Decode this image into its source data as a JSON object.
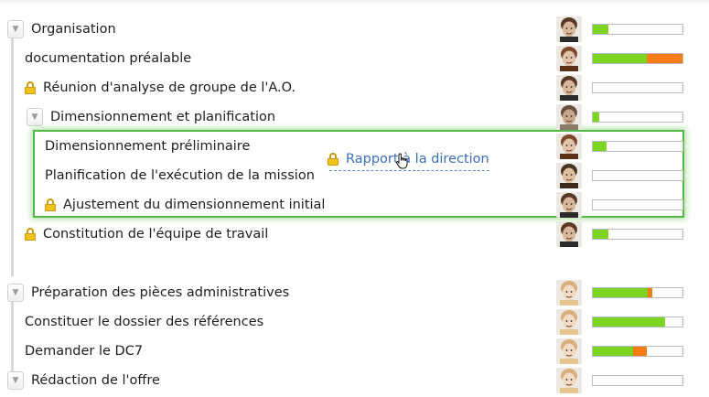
{
  "rows": [
    {
      "label": "Organisation",
      "avatar": "man-beard-icon",
      "progress": {
        "green": 0.17,
        "orange": 0
      }
    },
    {
      "label": "documentation préalable",
      "avatar": "woman-longhair-icon",
      "progress": {
        "green": 0.6,
        "orange": 0.4
      }
    },
    {
      "label": "Réunion d'analyse de groupe de l'A.O.",
      "avatar": "man-beard-icon",
      "progress": {
        "green": 0,
        "orange": 0
      }
    },
    {
      "label": "Dimensionnement et planification",
      "avatar": "man-portrait-icon",
      "progress": {
        "green": 0.07,
        "orange": 0
      }
    },
    {
      "label": "Dimensionnement préliminaire",
      "avatar": "woman-longhair-icon",
      "progress": {
        "green": 0.15,
        "orange": 0
      }
    },
    {
      "label": "Planification de l'exécution de la mission",
      "avatar": "man-smiling-icon",
      "progress": {
        "green": 0,
        "orange": 0
      }
    },
    {
      "label": "Ajustement du dimensionnement initial",
      "avatar": "man-beard-icon",
      "progress": {
        "green": 0,
        "orange": 0
      }
    },
    {
      "label": "Constitution de l'équipe de travail",
      "avatar": "man-beard-icon",
      "progress": {
        "green": 0.17,
        "orange": 0
      }
    },
    {
      "label": "Préparation des pièces administratives",
      "avatar": "blonde-woman-icon",
      "progress": {
        "green": 0.61,
        "orange": 0.05
      }
    },
    {
      "label": "Constituer le dossier des références",
      "avatar": "blonde-woman-icon",
      "progress": {
        "green": 0.81,
        "orange": 0
      }
    },
    {
      "label": "Demander le DC7",
      "avatar": "blonde-woman-icon",
      "progress": {
        "green": 0.45,
        "orange": 0.15
      }
    },
    {
      "label": "Rédaction de l'offre",
      "avatar": "blonde-woman-icon",
      "progress": {
        "green": 0,
        "orange": 0
      }
    }
  ],
  "drag_item": {
    "label": "Rapport à la direction"
  },
  "colors": {
    "progress_green": "#7ed321",
    "progress_orange": "#f57d13",
    "highlight_border": "#57b84a",
    "drag_text": "#3a6fb6"
  }
}
